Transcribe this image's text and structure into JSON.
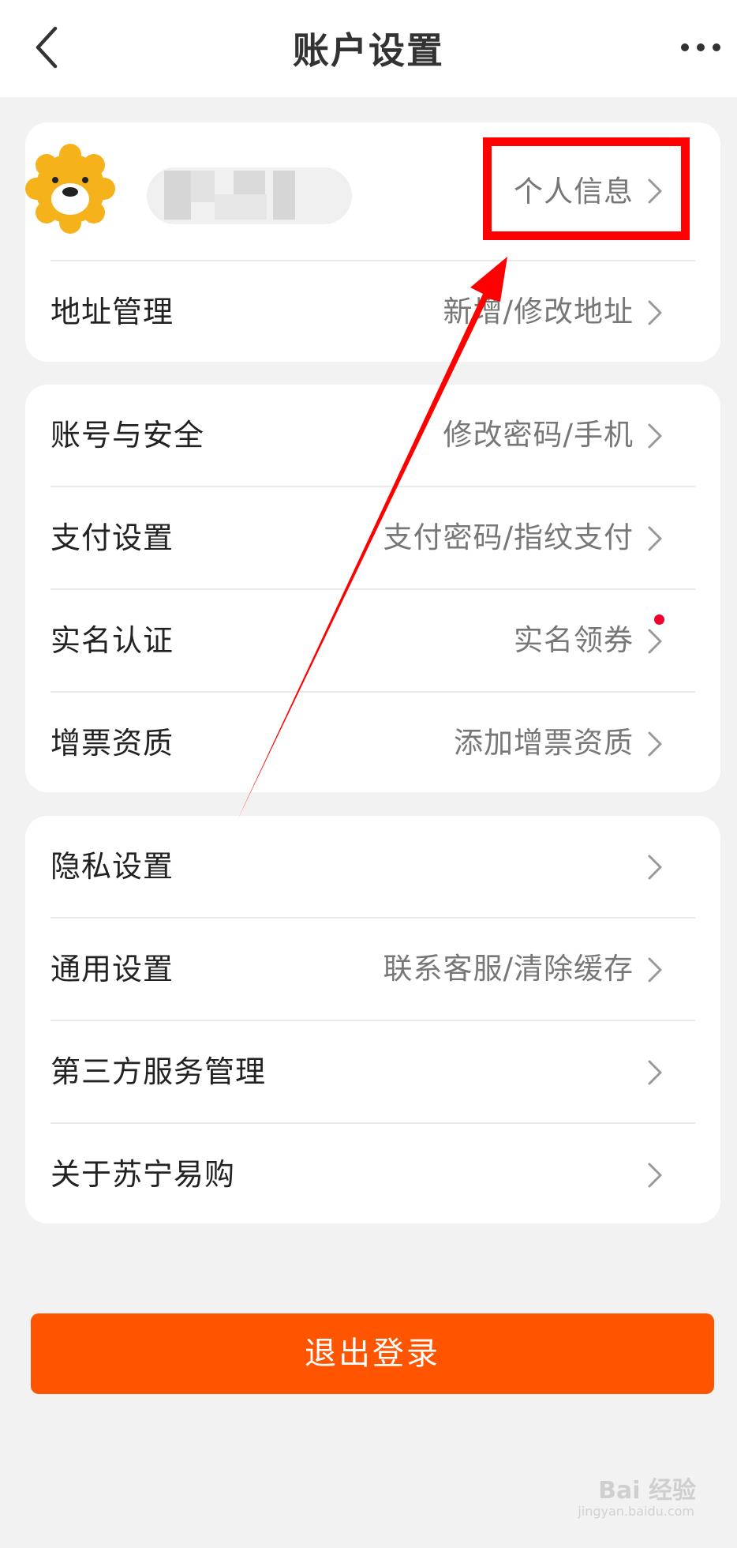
{
  "header": {
    "title": "账户设置",
    "back_icon": "chevron-left-icon",
    "more_icon": "more-dots-icon"
  },
  "profile": {
    "personal_info_label": "个人信息",
    "address_label": "地址管理",
    "address_value": "新增/修改地址"
  },
  "account": {
    "items": [
      {
        "label": "账号与安全",
        "value": "修改密码/手机"
      },
      {
        "label": "支付设置",
        "value": "支付密码/指纹支付"
      },
      {
        "label": "实名认证",
        "value": "实名领券"
      },
      {
        "label": "增票资质",
        "value": "添加增票资质"
      }
    ]
  },
  "general": {
    "items": [
      {
        "label": "隐私设置",
        "value": ""
      },
      {
        "label": "通用设置",
        "value": "联系客服/清除缓存"
      },
      {
        "label": "第三方服务管理",
        "value": ""
      },
      {
        "label": "关于苏宁易购",
        "value": ""
      }
    ]
  },
  "logout_label": "退出登录",
  "watermark": {
    "text": "Bai 经验",
    "sub": "jingyan.baidu.com"
  },
  "colors": {
    "accent": "#ff5500",
    "annotation": "#ff0000",
    "badge": "#f0002a",
    "background": "#f2f2f2"
  }
}
